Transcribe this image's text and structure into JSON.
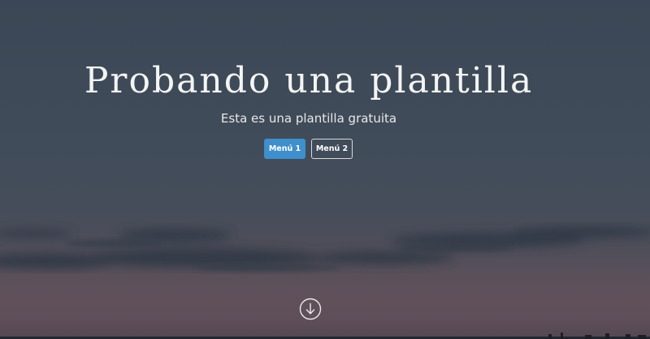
{
  "hero": {
    "title": "Probando una plantilla",
    "subtitle": "Esta es una plantilla gratuita"
  },
  "buttons": {
    "menu1_label": "Menú 1",
    "menu2_label": "Menú 2"
  },
  "icons": {
    "scroll": "arrow-down-circle-icon"
  },
  "colors": {
    "primary_button": "#3e8fcb",
    "text": "#f4f4f4"
  }
}
